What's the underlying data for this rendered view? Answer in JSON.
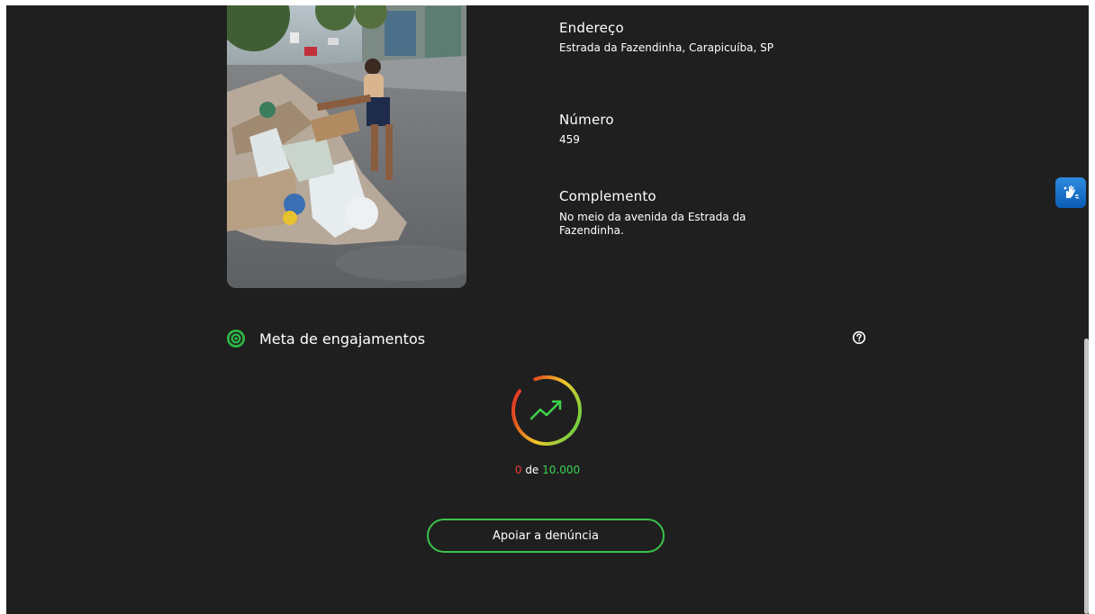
{
  "complaint": {
    "address": {
      "title": "Endereço",
      "value": "Estrada da Fazendinha, Carapicuíba, SP"
    },
    "number": {
      "title": "Número",
      "value": "459"
    },
    "complement": {
      "title": "Complemento",
      "value": "No meio da avenida da Estrada da Fazendinha."
    }
  },
  "engagement": {
    "title": "Meta de engajamentos",
    "current": "0",
    "separator": "de",
    "goal": "10.000",
    "progress_fraction": 0
  },
  "actions": {
    "support_label": "Apoiar a denúncia"
  },
  "icons": {
    "target": "target-icon",
    "help": "help-circle-icon",
    "trend": "trending-up-icon",
    "accessibility": "sign-language-icon"
  },
  "colors": {
    "background": "#1f1f1f",
    "accent_green": "#3cc24a",
    "current_red": "#e53935",
    "goal_green": "#39d353",
    "a11y_blue": "#1a73d0"
  }
}
